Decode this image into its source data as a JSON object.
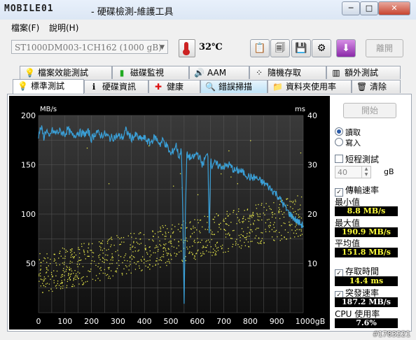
{
  "window": {
    "logo_text": "MOBILE01",
    "title": "- 硬碟檢測-維護工具",
    "controls": {
      "minimize": "─",
      "maximize": "□",
      "close": "✕"
    }
  },
  "menu": {
    "items": [
      "檔案(F)",
      "說明(H)"
    ]
  },
  "toolbar": {
    "drive_select": "ST1000DM003-1CH162 (1000 gB)",
    "temperature": "32℃",
    "icons": [
      "copy-text-icon",
      "copy-image-icon",
      "save-icon",
      "options-icon",
      "download-icon"
    ],
    "exit_label": "離開"
  },
  "tabs": {
    "row1": [
      {
        "label": "檔案效能測試",
        "icon": "lightbulb-icon"
      },
      {
        "label": "磁碟監視",
        "icon": "bar-chart-icon"
      },
      {
        "label": "AAM",
        "icon": "speaker-icon"
      },
      {
        "label": "隨機存取",
        "icon": "dots-icon"
      },
      {
        "label": "額外測試",
        "icon": "bars-icon"
      }
    ],
    "row2": [
      {
        "label": "標準測試",
        "icon": "bulb-icon",
        "active": true
      },
      {
        "label": "硬碟資訊",
        "icon": "info-icon"
      },
      {
        "label": "健康",
        "icon": "red-cross-icon"
      },
      {
        "label": "錯誤掃描",
        "icon": "magnifier-icon"
      },
      {
        "label": "資料夾使用率",
        "icon": "folder-icon"
      },
      {
        "label": "清除",
        "icon": "trash-icon"
      }
    ]
  },
  "side": {
    "start_label": "開始",
    "read_label": "讀取",
    "write_label": "寫入",
    "short_test_label": "短程測試",
    "short_test_value": "40",
    "short_test_unit": "gB",
    "transfer_label": "傳輸速率",
    "min_label": "最小值",
    "min_value": "8.8 MB/s",
    "max_label": "最大值",
    "max_value": "190.9 MB/s",
    "avg_label": "平均值",
    "avg_value": "151.8 MB/s",
    "access_label": "存取時間",
    "access_value": "14.4 ms",
    "burst_label": "突發速率",
    "burst_value": "187.2 MB/s",
    "cpu_label": "CPU 使用率",
    "cpu_value": "7.6%"
  },
  "watermark": "#1783221",
  "chart_data": {
    "type": "line",
    "y_left_label": "MB/s",
    "y_right_label": "ms",
    "x_ticks": [
      "0",
      "100",
      "200",
      "300",
      "400",
      "500",
      "600",
      "700",
      "800",
      "900",
      "1000gB"
    ],
    "y_left_ticks": [
      "200",
      "150",
      "100",
      "50"
    ],
    "y_right_ticks": [
      "40",
      "30",
      "20",
      "10"
    ],
    "xlim": [
      0,
      1000
    ],
    "ylim_left": [
      0,
      200
    ],
    "ylim_right": [
      0,
      40
    ],
    "series": [
      {
        "type": "line",
        "color": "#3aa0d8",
        "axis": "left",
        "x": [
          0,
          10,
          20,
          30,
          40,
          50,
          60,
          80,
          100,
          110,
          130,
          150,
          170,
          190,
          200,
          220,
          230,
          250,
          270,
          300,
          320,
          330,
          350,
          370,
          380,
          400,
          420,
          440,
          460,
          470,
          480,
          490,
          500,
          520,
          530,
          540,
          545,
          550,
          555,
          560,
          580,
          600,
          620,
          630,
          640,
          645,
          650,
          655,
          660,
          680,
          700,
          720,
          740,
          760,
          780,
          800,
          820,
          840,
          860,
          880,
          900,
          920,
          940,
          960,
          980,
          1000
        ],
        "y": [
          180,
          188,
          178,
          186,
          176,
          185,
          182,
          184,
          181,
          186,
          179,
          183,
          181,
          183,
          176,
          184,
          180,
          181,
          177,
          179,
          178,
          185,
          177,
          180,
          176,
          177,
          172,
          178,
          171,
          175,
          171,
          166,
          160,
          170,
          158,
          165,
          100,
          9,
          100,
          160,
          156,
          162,
          150,
          157,
          160,
          80,
          155,
          148,
          152,
          149,
          148,
          150,
          144,
          144,
          141,
          137,
          137,
          133,
          130,
          125,
          120,
          112,
          103,
          97,
          92,
          88
        ]
      },
      {
        "type": "scatter",
        "color": "#e8e84a",
        "axis": "right",
        "description_note": "access time samples",
        "x_range": [
          0,
          1000
        ],
        "y_trend_start": 8,
        "y_trend_end": 20,
        "y_spread": 7
      }
    ],
    "grid": true
  }
}
